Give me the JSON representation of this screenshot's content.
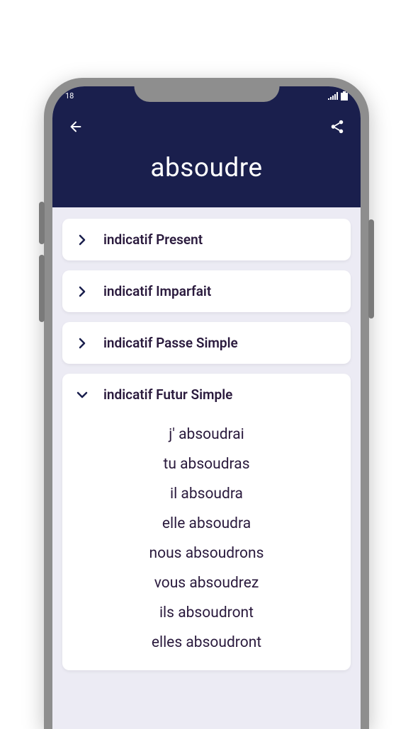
{
  "status": {
    "time_fragment": "18"
  },
  "header": {
    "title": "absoudre"
  },
  "sections": [
    {
      "label": "indicatif Present",
      "expanded": false,
      "lines": []
    },
    {
      "label": "indicatif Imparfait",
      "expanded": false,
      "lines": []
    },
    {
      "label": "indicatif Passe Simple",
      "expanded": false,
      "lines": []
    },
    {
      "label": "indicatif Futur Simple",
      "expanded": true,
      "lines": [
        "j' absoudrai",
        "tu absoudras",
        "il absoudra",
        "elle absoudra",
        "nous absoudrons",
        "vous absoudrez",
        "ils absoudront",
        "elles absoudront"
      ]
    }
  ],
  "colors": {
    "header_bg": "#1a1f4d",
    "content_bg": "#ecebf4",
    "text_dark": "#2a1a3d"
  }
}
